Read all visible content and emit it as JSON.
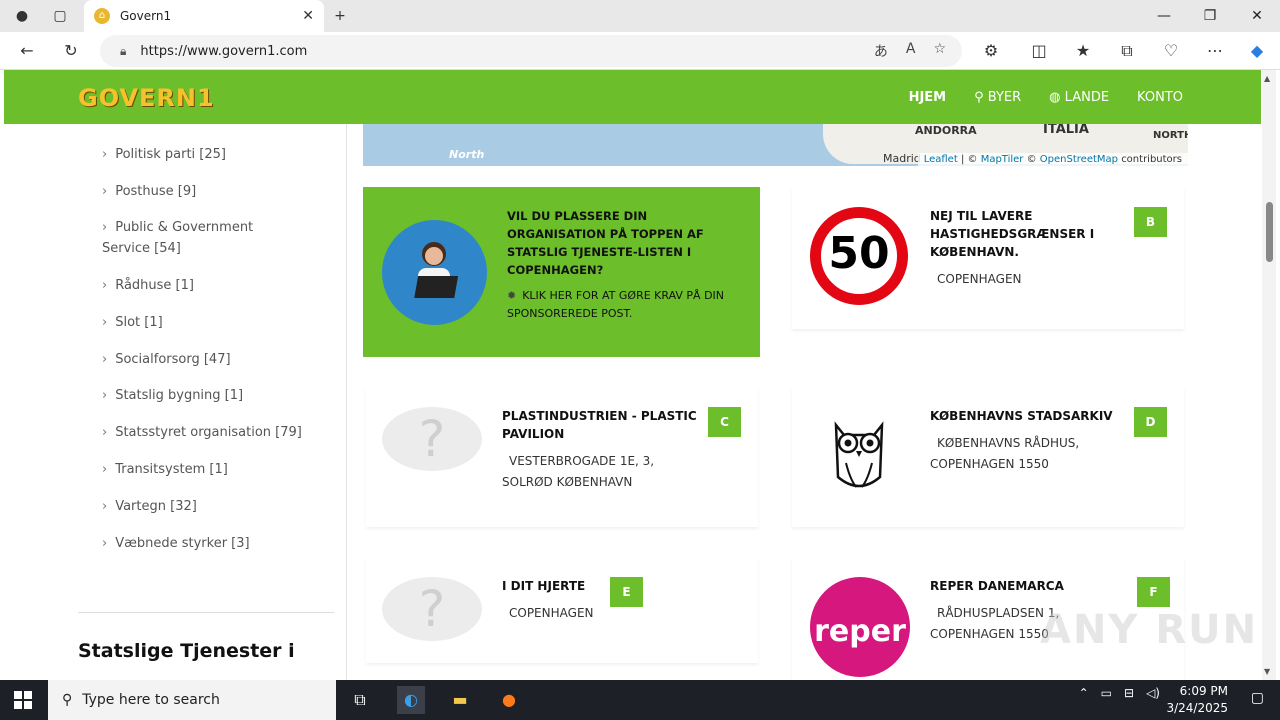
{
  "browser": {
    "tab_title": "Govern1",
    "url": "https://www.govern1.com",
    "window_controls": [
      "—",
      "❐",
      "✕"
    ]
  },
  "site": {
    "logo": "GOVERN1",
    "nav": [
      "HJEM",
      "BYER",
      "LANDE",
      "KONTO"
    ]
  },
  "sidebar": {
    "items": [
      "Politisk parti [25]",
      "Posthuse [9]",
      "Public & Government Service [54]",
      "Rådhuse [1]",
      "Slot [1]",
      "Socialforsorg [47]",
      "Statslig bygning [1]",
      "Statsstyret organisation [79]",
      "Transitsystem [1]",
      "Vartegn [32]",
      "Væbnede styrker [3]"
    ],
    "section_title": "Statslige Tjenester i"
  },
  "map": {
    "labels": [
      "ANDORRA",
      "ITALIA",
      "North",
      "Madrid",
      "NORTH"
    ],
    "attribution": {
      "leaflet": "Leaflet",
      "sep1": "| ©",
      "maptiler": "MapTiler",
      "sep2": "©",
      "osm": "OpenStreetMap",
      "tail": "contributors"
    }
  },
  "promo": {
    "headline": "VIL DU PLASSERE DIN ORGANISATION PÅ TOPPEN AF STATSLIG TJENESTE-LISTEN I COPENHAGEN?",
    "cta": "KLIK HER FOR AT GØRE KRAV PÅ DIN SPONSOREREDE POST."
  },
  "cards": [
    {
      "badge": "B",
      "name": "NEJ TIL LAVERE HASTIGHEDSGRÆNSER I KØBENHAVN.",
      "address": "COPENHAGEN",
      "image": "speed-sign-50",
      "sign_text": "50"
    },
    {
      "badge": "C",
      "name": "PLASTINDUSTRIEN - PLASTIC PAVILION",
      "address": "VESTERBROGADE 1E, 3, SOLRØD KØBENHAVN",
      "image": "placeholder"
    },
    {
      "badge": "D",
      "name": "KØBENHAVNS STADSARKIV",
      "address": "KØBENHAVNS RÅDHUS, COPENHAGEN 1550",
      "image": "owl"
    },
    {
      "badge": "E",
      "name": "I DIT HJERTE",
      "address": "COPENHAGEN",
      "image": "placeholder"
    },
    {
      "badge": "F",
      "name": "REPER DANEMARCA",
      "address": "RÅDHUSPLADSEN 1, COPENHAGEN 1550",
      "image": "reper-logo",
      "logo_text": "reper"
    }
  ],
  "taskbar": {
    "search_placeholder": "Type here to search",
    "time": "6:09 PM",
    "date": "3/24/2025"
  },
  "watermark": "ANY RUN",
  "colors": {
    "brand_green": "#6cbf2a",
    "logo_gold": "#f6c12c"
  }
}
